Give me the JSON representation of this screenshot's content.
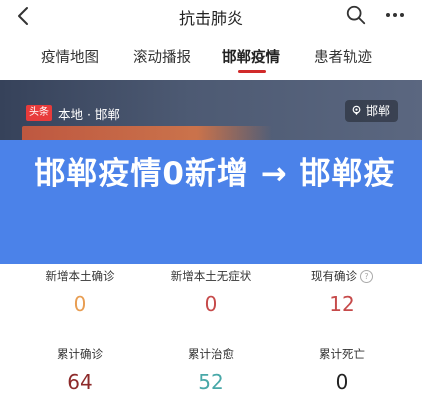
{
  "header": {
    "title": "抗击肺炎"
  },
  "tabs": [
    {
      "label": "疫情地图"
    },
    {
      "label": "滚动播报"
    },
    {
      "label": "邯郸疫情",
      "active": true
    },
    {
      "label": "患者轨迹"
    }
  ],
  "banner": {
    "badge": "头条",
    "source": "本地 · 邯郸",
    "location": "邯郸"
  },
  "overlay": {
    "text": "邯郸疫情0新增 → 邯郸疫"
  },
  "stats": {
    "row1": [
      {
        "label": "新增本土确诊",
        "value": "0"
      },
      {
        "label": "新增本土无症状",
        "value": "0"
      },
      {
        "label": "现有确诊",
        "value": "12"
      }
    ],
    "row2": [
      {
        "label": "累计确诊",
        "value": "64"
      },
      {
        "label": "累计治愈",
        "value": "52"
      },
      {
        "label": "累计死亡",
        "value": "0"
      }
    ]
  },
  "colors": {
    "accent": "#d12a2a",
    "overlay": "#4b82e9",
    "value_orange": "#e89d52",
    "value_red": "#c64a4a",
    "value_dark_red": "#8d2a2a",
    "value_teal": "#48a8a8",
    "value_black": "#222222"
  },
  "icons": [
    "back-icon",
    "search-icon",
    "more-icon",
    "location-pin-icon",
    "info-icon"
  ]
}
